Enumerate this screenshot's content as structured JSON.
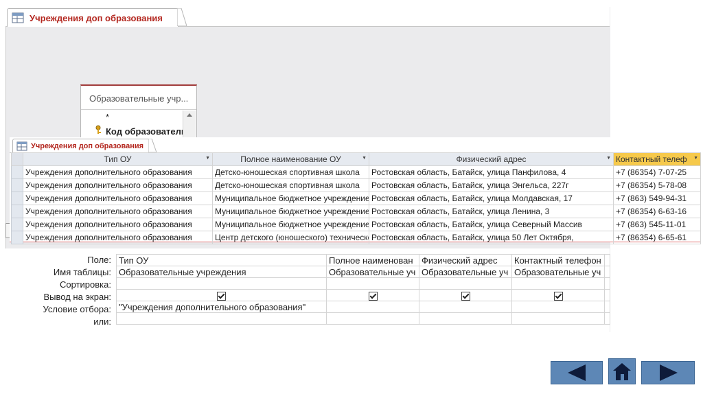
{
  "design": {
    "tab_title": "Учреждения доп образования",
    "field_list": {
      "title": "Образовательные учр...",
      "items": [
        "*",
        "Код образователь"
      ]
    }
  },
  "datasheet": {
    "tab_title": "Учреждения доп образования",
    "columns": [
      "Тип ОУ",
      "Полное наименование ОУ",
      "Физический адрес",
      "Контактный телеф"
    ],
    "rows": [
      [
        "Учреждения дополнительного образования",
        "Детско-юношеская спортивная школа",
        "Ростовская область, Батайск, улица Панфилова, 4",
        "+7 (86354) 7-07-25"
      ],
      [
        "Учреждения дополнительного образования",
        "Детско-юношеская спортивная школа",
        "Ростовская область, Батайск, улица Энгельса, 227г",
        "+7 (86354) 5-78-08"
      ],
      [
        "Учреждения дополнительного образования",
        "Муниципальное бюджетное учреждение",
        "Ростовская область, Батайск, улица Молдавская, 17",
        "+7 (863) 549-94-31"
      ],
      [
        "Учреждения дополнительного образования",
        "Муниципальное бюджетное учреждение",
        "Ростовская область, Батайск, улица Ленина, 3",
        "+7 (86354) 6-63-16"
      ],
      [
        "Учреждения дополнительного образования",
        "Муниципальное бюджетное учреждение",
        "Ростовская область, Батайск, улица Северный Массив",
        "+7 (863) 545-11-01"
      ],
      [
        "Учреждения дополнительного образования",
        "Центр детского (юношеского) технического",
        "Ростовская область, Батайск, улица 50 Лет Октября,",
        "+7 (86354) 6-65-61"
      ]
    ]
  },
  "qbe": {
    "labels": [
      "Поле:",
      "Имя таблицы:",
      "Сортировка:",
      "Вывод на экран:",
      "Условие отбора:",
      "или:"
    ],
    "fields": [
      "Тип ОУ",
      "Полное наименован",
      "Физический адрес",
      "Контактный телефон"
    ],
    "tables": [
      "Образовательные учреждения",
      "Образовательные уч",
      "Образовательные уч",
      "Образовательные уч"
    ],
    "criteria": [
      "\"Учреждения дополнительного образования\"",
      "",
      "",
      ""
    ]
  },
  "colors": {
    "accent": "#b3261e",
    "active_header": "#f6c94b",
    "nav_button": "#5d87b6"
  },
  "nav_icons": [
    "arrow-left-icon",
    "home-icon",
    "arrow-right-icon"
  ]
}
